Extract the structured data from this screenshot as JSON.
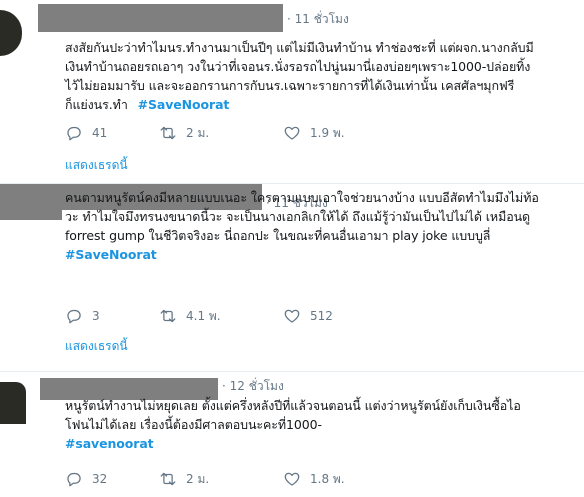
{
  "tweets": [
    {
      "time": "· 11 ชั่วโมง",
      "lines": [
        "สงสัยกันปะว่าทำไมนร.ทำงานมาเป็นปีๆ แต่ไม่มีเงินทำบ้าน ทำช่องชะที่ แต่ผจก.นางกลับมี",
        "เงินทำบ้านถอยรถเอาๆ วงในว่าที่เจอนร.นั่งรอรถไปนู่นมานี่เองบ่อยๆเพราะ1000-ปล่อยทิ้ง",
        "ไว้ไม่ยอมมารับ และจะออกรานการกับนร.เฉพาะรายการที่ได้เงินเท่านั้น เคสศัลฯมุกฟรี"
      ],
      "last_line": "ก็แย่งนร.ทำ",
      "hashtag": "#SaveNoorat",
      "replies": "41",
      "retweets": "2 ม.",
      "likes": "1.9 พ.",
      "thread_label": "แสดงเธรดนี้"
    },
    {
      "time": "· 11 ชั่วโมง",
      "lines": [
        "คนตามหนูรัตน์คงมีหลายแบบเนอะ ใครตามแบบเอาใจช่วยนางบ้าง แบบอีสัดทำไมมึงไม่ท้อ",
        "วะ ทำไมใจมึงทรนงขนาดนี้วะ จะเป็นนางเอกลิเกให้ได้ ถึงแม้รู้ว่ามันเป็นไปไม่ได้ เหมือนดู",
        "forrest gump ในชีวิตจริงอะ นี่ถอกปะ ในขณะที่คนอื่นเอามา play joke แบบบูลี่"
      ],
      "last_line": "",
      "hashtag": "#SaveNoorat",
      "replies": "3",
      "retweets": "4.1 พ.",
      "likes": "512",
      "thread_label": "แสดงเธรดนี้"
    },
    {
      "time": "· 12 ชั่วโมง",
      "lines": [
        "หนูรัตน์ทำงานไม่หยุดเลย ตั้งแต่ครึ่งหลังปีที่แล้วจนตอนนี้ แต่งว่าหนูรัตน์ยังเก็บเงินซื้อไอ",
        "โฟนไม่ได้เลย เรื่องนี้ต้องมีศาลตอบนะคะที่1000-"
      ],
      "last_line": "",
      "hashtag": "#savenoorat",
      "replies": "32",
      "retweets": "2 ม.",
      "likes": "1.8 พ.",
      "thread_label": ""
    }
  ],
  "icons": {
    "reply": "reply-icon",
    "retweet": "retweet-icon",
    "like": "heart-icon"
  },
  "colors": {
    "link": "#1b95e0",
    "muted": "#657786",
    "redaction": "#7f7f7f"
  }
}
